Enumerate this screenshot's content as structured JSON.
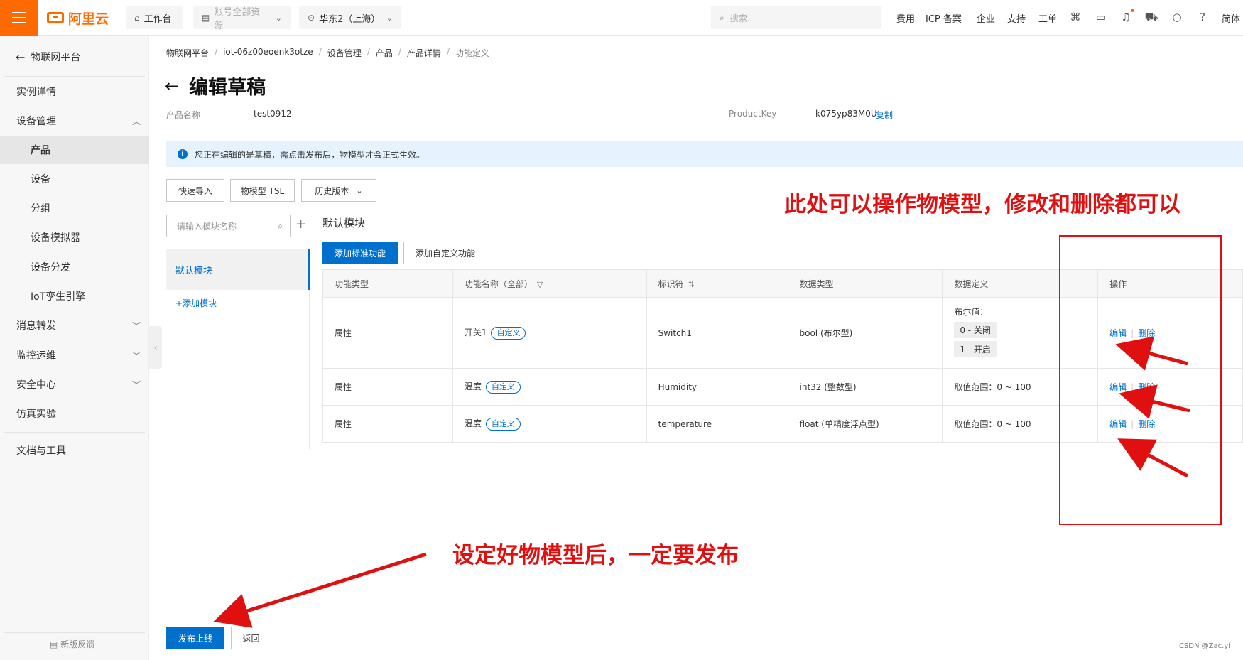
{
  "topbar": {
    "logo_text": "阿里云",
    "workbench": "工作台",
    "resource_scope": "账号全部资源",
    "region": "华东2（上海）",
    "search_placeholder": "搜索...",
    "nav": [
      "费用",
      "ICP 备案",
      "企业",
      "支持",
      "工单"
    ],
    "user_label": "简体"
  },
  "sidebar": {
    "back_label": "物联网平台",
    "items": [
      {
        "label": "实例详情"
      },
      {
        "label": "设备管理"
      },
      {
        "label": "产品"
      },
      {
        "label": "设备"
      },
      {
        "label": "分组"
      },
      {
        "label": "设备模拟器"
      },
      {
        "label": "设备分发"
      },
      {
        "label": "IoT孪生引擎"
      },
      {
        "label": "消息转发"
      },
      {
        "label": "监控运维"
      },
      {
        "label": "安全中心"
      },
      {
        "label": "仿真实验"
      },
      {
        "label": "文档与工具"
      }
    ],
    "feedback": "新版反馈"
  },
  "breadcrumb": [
    "物联网平台",
    "iot-06z00eoenk3otze",
    "设备管理",
    "产品",
    "产品详情",
    "功能定义"
  ],
  "page": {
    "title": "编辑草稿",
    "product_name_label": "产品名称",
    "product_name": "test0912",
    "product_key_label": "ProductKey",
    "product_key": "k075yp83M0U",
    "copy_label": "复制"
  },
  "notice": "您正在编辑的是草稿，需点击发布后，物模型才会正式生效。",
  "toolbar": {
    "quick_import": "快速导入",
    "tsl": "物模型 TSL",
    "history": "历史版本"
  },
  "modules": {
    "search_placeholder": "请输入模块名称",
    "items": [
      "默认模块"
    ],
    "add_label": "+添加模块"
  },
  "section": {
    "title": "默认模块",
    "add_standard": "添加标准功能",
    "add_custom": "添加自定义功能"
  },
  "table": {
    "headers": [
      "功能类型",
      "功能名称（全部）",
      "标识符",
      "数据类型",
      "数据定义",
      "操作"
    ],
    "rows": [
      {
        "type": "属性",
        "name": "开关1",
        "tag": "自定义",
        "identifier": "Switch1",
        "data_type": "bool (布尔型)",
        "def_title": "布尔值：",
        "def_values": [
          "0 - 关闭",
          "1 - 开启"
        ],
        "edit": "编辑",
        "delete": "删除"
      },
      {
        "type": "属性",
        "name": "温度",
        "tag": "自定义",
        "identifier": "Humidity",
        "data_type": "int32 (整数型)",
        "def_text": "取值范围：0 ~ 100",
        "edit": "编辑",
        "delete": "删除"
      },
      {
        "type": "属性",
        "name": "温度",
        "tag": "自定义",
        "identifier": "temperature",
        "data_type": "float (单精度浮点型)",
        "def_text": "取值范围：0 ~ 100",
        "edit": "编辑",
        "delete": "删除"
      }
    ]
  },
  "footer": {
    "publish": "发布上线",
    "back": "返回",
    "watermark": "CSDN @Zac.yi"
  },
  "annotations": {
    "top_note": "此处可以操作物模型，修改和删除都可以",
    "bottom_note": "设定好物模型后，一定要发布",
    "color": "#e01010"
  },
  "colors": {
    "brand": "#ff6a00",
    "primary": "#0070cc"
  }
}
